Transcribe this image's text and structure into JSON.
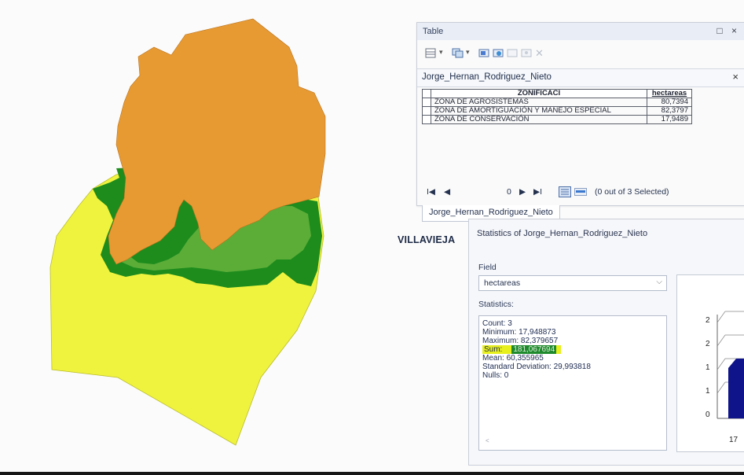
{
  "map": {
    "colors": {
      "conservacion": "#f0f33e",
      "amortiguacion": "#1d8c1d",
      "agrosistemas": "#e89a32",
      "fringe": "#5aa83a"
    }
  },
  "table_window": {
    "title": "Table",
    "controls": "□ ×",
    "layer_tab": "Jorge_Hernan_Rodriguez_Nieto",
    "close": "×",
    "columns": [
      "ZONIFICACI",
      "hectareas"
    ],
    "rows": [
      {
        "zonificaci": "ZONA DE AGROSISTEMAS",
        "hectareas": "80,7394"
      },
      {
        "zonificaci": "ZONA DE AMORTIGUACIÓN Y MANEJO ESPECIAL",
        "hectareas": "82,3797"
      },
      {
        "zonificaci": "ZONA DE CONSERVACIÓN",
        "hectareas": "17,9489"
      }
    ],
    "nav": {
      "first": "I◀",
      "prev": "◀",
      "record": "0",
      "next": "▶",
      "last": "▶I",
      "selected": "(0 out of 3 Selected)"
    },
    "sheet_tab": "Jorge_Hernan_Rodriguez_Nieto"
  },
  "map_label": "VILLAVIEJA",
  "statistics_window": {
    "title": "Statistics of Jorge_Hernan_Rodriguez_Nieto",
    "field_label": "Field",
    "field_value": "hectareas",
    "statistics_label": "Statistics:",
    "stats": {
      "count": "Count:    3",
      "minimum": "Minimum:  17,948873",
      "maximum": "Maximum: 82,379657",
      "sum_label": "Sum:",
      "sum_value": "181,067694",
      "mean": "Mean:      60,355965",
      "std": "Standard Deviation: 29,993818",
      "nulls": "Nulls:     0"
    },
    "chart": {
      "y_ticks": [
        "2",
        "2",
        "1",
        "1",
        "0"
      ],
      "x_tick": "17",
      "bar_color": "#10148a"
    }
  }
}
